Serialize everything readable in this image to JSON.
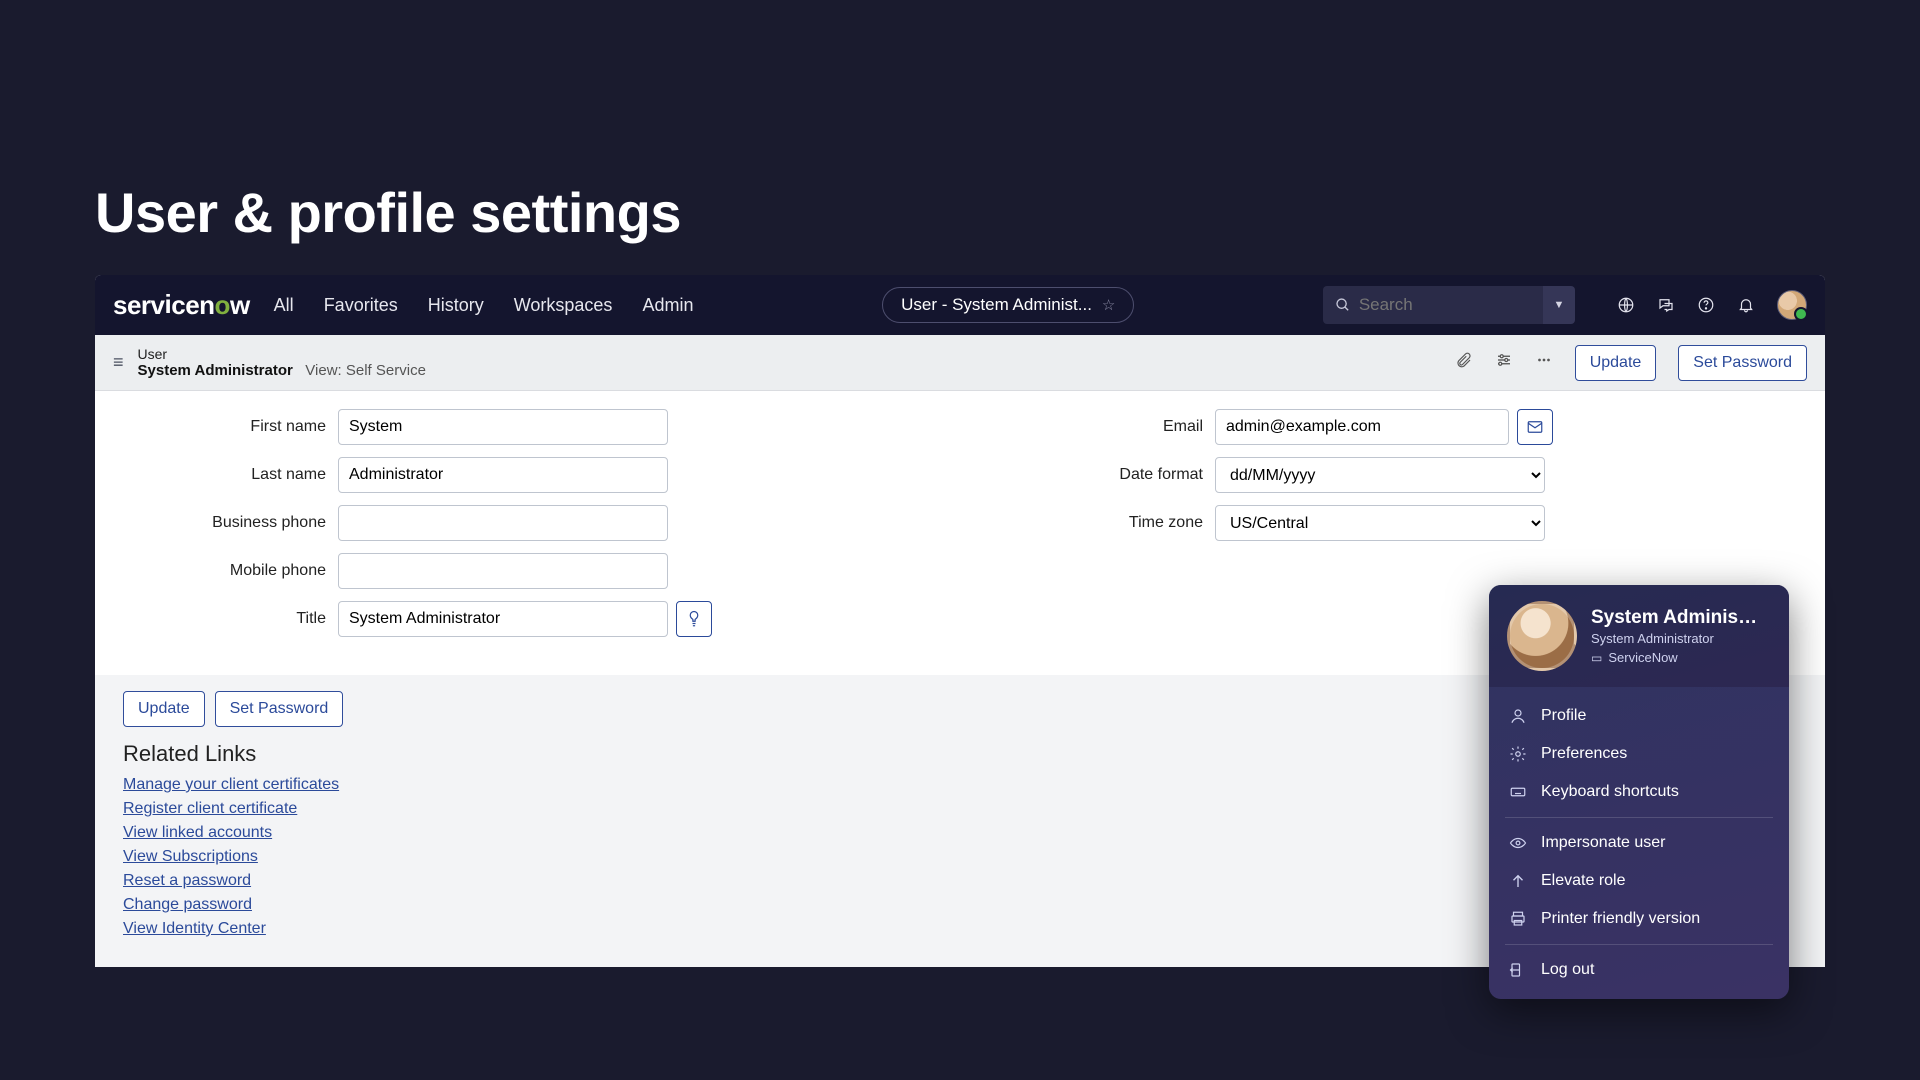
{
  "pageTitle": "User & profile settings",
  "brand": {
    "name": "servicenow"
  },
  "nav": {
    "items": [
      "All",
      "Favorites",
      "History",
      "Workspaces",
      "Admin"
    ]
  },
  "breadcrumb": "User - System Administ...",
  "search": {
    "placeholder": "Search"
  },
  "subheader": {
    "kicker": "User",
    "name": "System Administrator",
    "view": "View: Self Service",
    "updateLabel": "Update",
    "setPasswordLabel": "Set Password"
  },
  "form": {
    "left": {
      "firstName": {
        "label": "First name",
        "value": "System"
      },
      "lastName": {
        "label": "Last name",
        "value": "Administrator"
      },
      "businessPhone": {
        "label": "Business phone",
        "value": ""
      },
      "mobilePhone": {
        "label": "Mobile phone",
        "value": ""
      },
      "title": {
        "label": "Title",
        "value": "System Administrator"
      }
    },
    "right": {
      "email": {
        "label": "Email",
        "value": "admin@example.com"
      },
      "dateFormat": {
        "label": "Date format",
        "value": "dd/MM/yyyy"
      },
      "timeZone": {
        "label": "Time zone",
        "value": "US/Central"
      }
    }
  },
  "bottomButtons": {
    "update": "Update",
    "setPassword": "Set Password"
  },
  "related": {
    "title": "Related Links",
    "links": [
      "Manage your client certificates",
      "Register client certificate",
      "View linked accounts",
      "View Subscriptions",
      "Reset a password",
      "Change password",
      "View Identity Center"
    ]
  },
  "profileMenu": {
    "name": "System Administra...",
    "role": "System Administrator",
    "org": "ServiceNow",
    "items1": [
      "Profile",
      "Preferences",
      "Keyboard shortcuts"
    ],
    "items2": [
      "Impersonate user",
      "Elevate role",
      "Printer friendly version"
    ],
    "items3": [
      "Log out"
    ]
  }
}
